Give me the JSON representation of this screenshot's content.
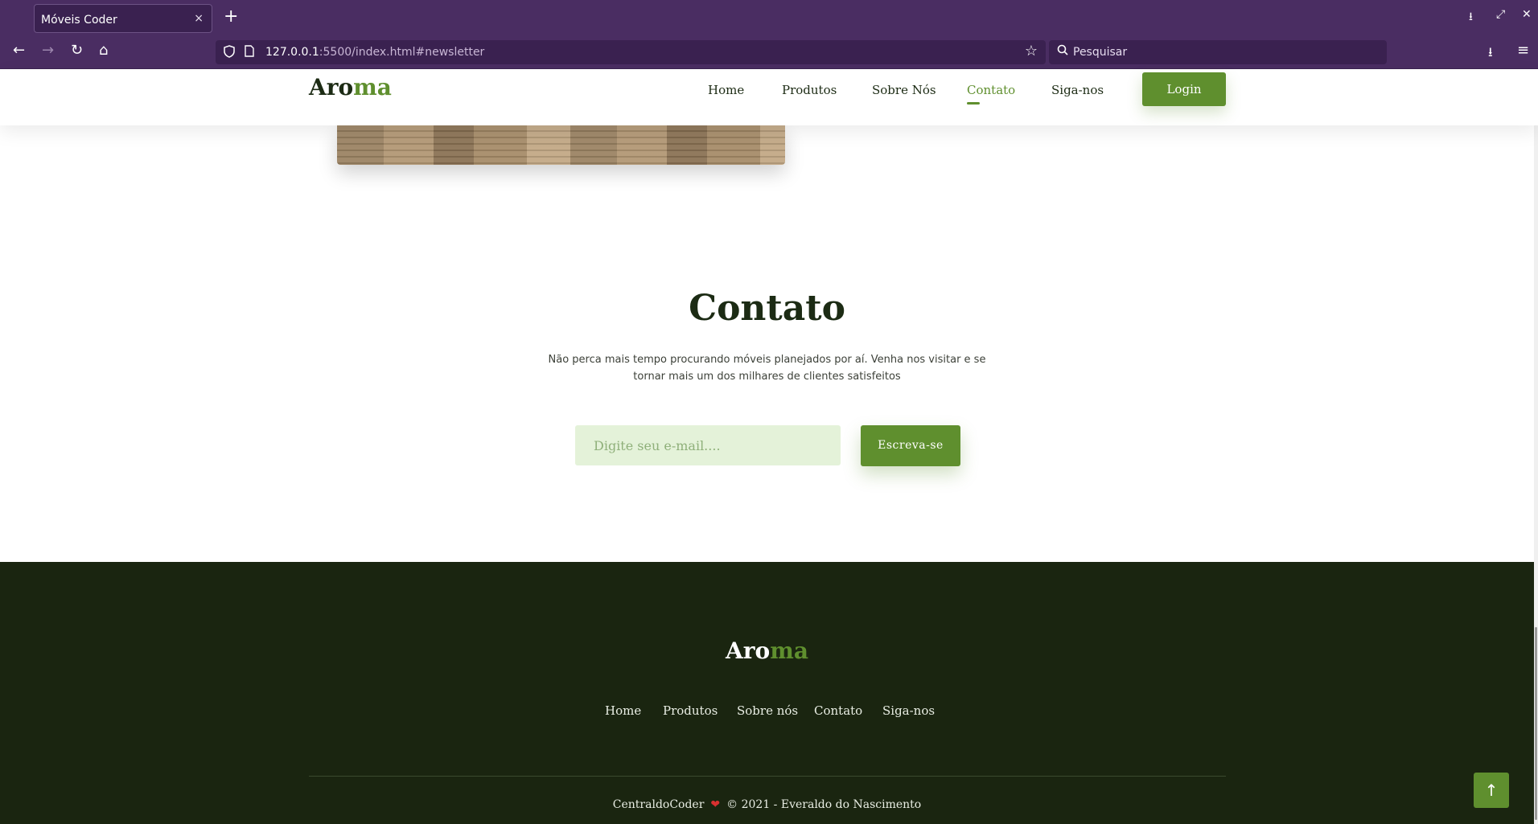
{
  "browser": {
    "tab_title": "Móveis Coder",
    "tab_close": "×",
    "new_tab": "+",
    "url_host": "127.0.0.1",
    "url_rest": ":5500/index.html#newsletter",
    "search_placeholder": "Pesquisar",
    "back": "←",
    "forward": "→",
    "reload": "↻",
    "home": "⌂",
    "bookmark": "☆",
    "downloads": "⭳",
    "menu": "≡",
    "minimize": "⭳",
    "maximize": "⤢",
    "close": "✕"
  },
  "header": {
    "logo_main": "Aro",
    "logo_accent": "ma",
    "nav": [
      "Home",
      "Produtos",
      "Sobre Nós",
      "Contato",
      "Siga-nos"
    ],
    "active_nav": "Contato",
    "login_label": "Login"
  },
  "contact": {
    "title": "Contato",
    "text": "Não perca mais tempo procurando móveis planejados por aí. Venha nos visitar e se tornar mais um dos milhares de clientes satisfeitos",
    "email_placeholder": "Digite seu e-mail....",
    "subscribe_label": "Escreva-se"
  },
  "footer": {
    "logo_main": "Aro",
    "logo_accent": "ma",
    "links": [
      "Home",
      "Produtos",
      "Sobre nós",
      "Contato",
      "Siga-nos"
    ],
    "credit_left": "CentraldoCoder",
    "heart": "❤",
    "credit_right": "© 2021 - Everaldo do Nascimento",
    "back_to_top": "↑"
  },
  "colors": {
    "browser_chrome": "#4a2d62",
    "accent_green": "#5f8f2e",
    "dark_text": "#1c2b14",
    "footer_bg": "#1a2510",
    "input_bg": "#e4f2d9"
  }
}
